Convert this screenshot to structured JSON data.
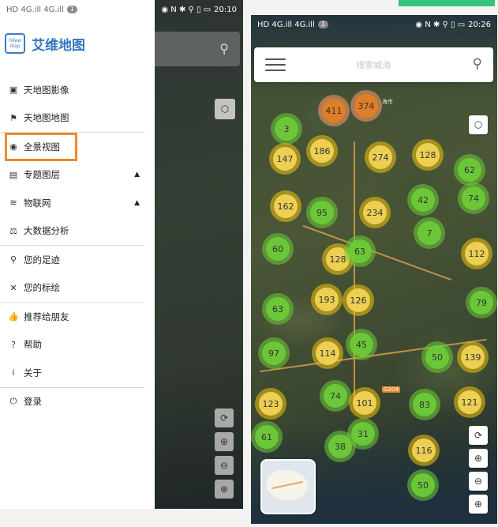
{
  "left_screen": {
    "status": {
      "carrier": "HD 4G.ill 4G.ill",
      "notif_count": "1",
      "icons": "◉ N ✱ ⚲ ▯ ▭",
      "time": "20:10"
    },
    "app": {
      "logo_text": "iView map",
      "title": "艾维地图"
    },
    "menu": [
      {
        "icon": "image-icon",
        "glyph": "▣",
        "label": "天地图影像",
        "caret": ""
      },
      {
        "icon": "map-pin-icon",
        "glyph": "⚑",
        "label": "天地图地图",
        "caret": ""
      },
      {
        "icon": "panorama-icon",
        "glyph": "◉",
        "label": "全景视图",
        "caret": "",
        "highlight": true
      },
      {
        "icon": "layers-icon",
        "glyph": "▤",
        "label": "专题图层",
        "caret": "▲"
      },
      {
        "icon": "iot-icon",
        "glyph": "≋",
        "label": "物联网",
        "caret": "▲"
      },
      {
        "icon": "analysis-icon",
        "glyph": "⚖",
        "label": "大数据分析",
        "caret": ""
      },
      {
        "icon": "footprint-icon",
        "glyph": "⚲",
        "label": "您的足迹",
        "caret": ""
      },
      {
        "icon": "tag-icon",
        "glyph": "✕",
        "label": "您的标绘",
        "caret": ""
      },
      {
        "icon": "thumbs-up-icon",
        "glyph": "👍",
        "label": "推荐给朋友",
        "caret": ""
      },
      {
        "icon": "help-icon",
        "glyph": "?",
        "label": "帮助",
        "caret": ""
      },
      {
        "icon": "info-icon",
        "glyph": "i",
        "label": "关于",
        "caret": ""
      },
      {
        "icon": "login-icon",
        "glyph": "⏻",
        "label": "登录",
        "caret": ""
      }
    ]
  },
  "right_screen": {
    "status": {
      "carrier": "HD 4G.ill 4G.ill",
      "notif_count": "1",
      "icons": "◉ N ✱ ⚲ ▯ ▭",
      "time": "20:26"
    },
    "search": {
      "placeholder": "搜索威海"
    },
    "clusters": [
      {
        "value": "411",
        "color": "orange"
      },
      {
        "value": "374",
        "color": "orange"
      },
      {
        "value": "3",
        "color": "green"
      },
      {
        "value": "186",
        "color": "yellow"
      },
      {
        "value": "147",
        "color": "yellow"
      },
      {
        "value": "274",
        "color": "yellow"
      },
      {
        "value": "128",
        "color": "yellow"
      },
      {
        "value": "62",
        "color": "green"
      },
      {
        "value": "74",
        "color": "green"
      },
      {
        "value": "42",
        "color": "green"
      },
      {
        "value": "162",
        "color": "yellow"
      },
      {
        "value": "95",
        "color": "green"
      },
      {
        "value": "234",
        "color": "yellow"
      },
      {
        "value": "7",
        "color": "green"
      },
      {
        "value": "60",
        "color": "green"
      },
      {
        "value": "128",
        "color": "yellow"
      },
      {
        "value": "63",
        "color": "green"
      },
      {
        "value": "112",
        "color": "yellow"
      },
      {
        "value": "193",
        "color": "yellow"
      },
      {
        "value": "126",
        "color": "yellow"
      },
      {
        "value": "63",
        "color": "green"
      },
      {
        "value": "79",
        "color": "green"
      },
      {
        "value": "97",
        "color": "green"
      },
      {
        "value": "114",
        "color": "yellow"
      },
      {
        "value": "45",
        "color": "green"
      },
      {
        "value": "50",
        "color": "green"
      },
      {
        "value": "139",
        "color": "yellow"
      },
      {
        "value": "123",
        "color": "yellow"
      },
      {
        "value": "74",
        "color": "green"
      },
      {
        "value": "101",
        "color": "yellow"
      },
      {
        "value": "83",
        "color": "green"
      },
      {
        "value": "121",
        "color": "yellow"
      },
      {
        "value": "61",
        "color": "green"
      },
      {
        "value": "38",
        "color": "green"
      },
      {
        "value": "31",
        "color": "green"
      },
      {
        "value": "116",
        "color": "yellow"
      },
      {
        "value": "50",
        "color": "green"
      }
    ],
    "labels": [
      "海市",
      "G204"
    ]
  }
}
